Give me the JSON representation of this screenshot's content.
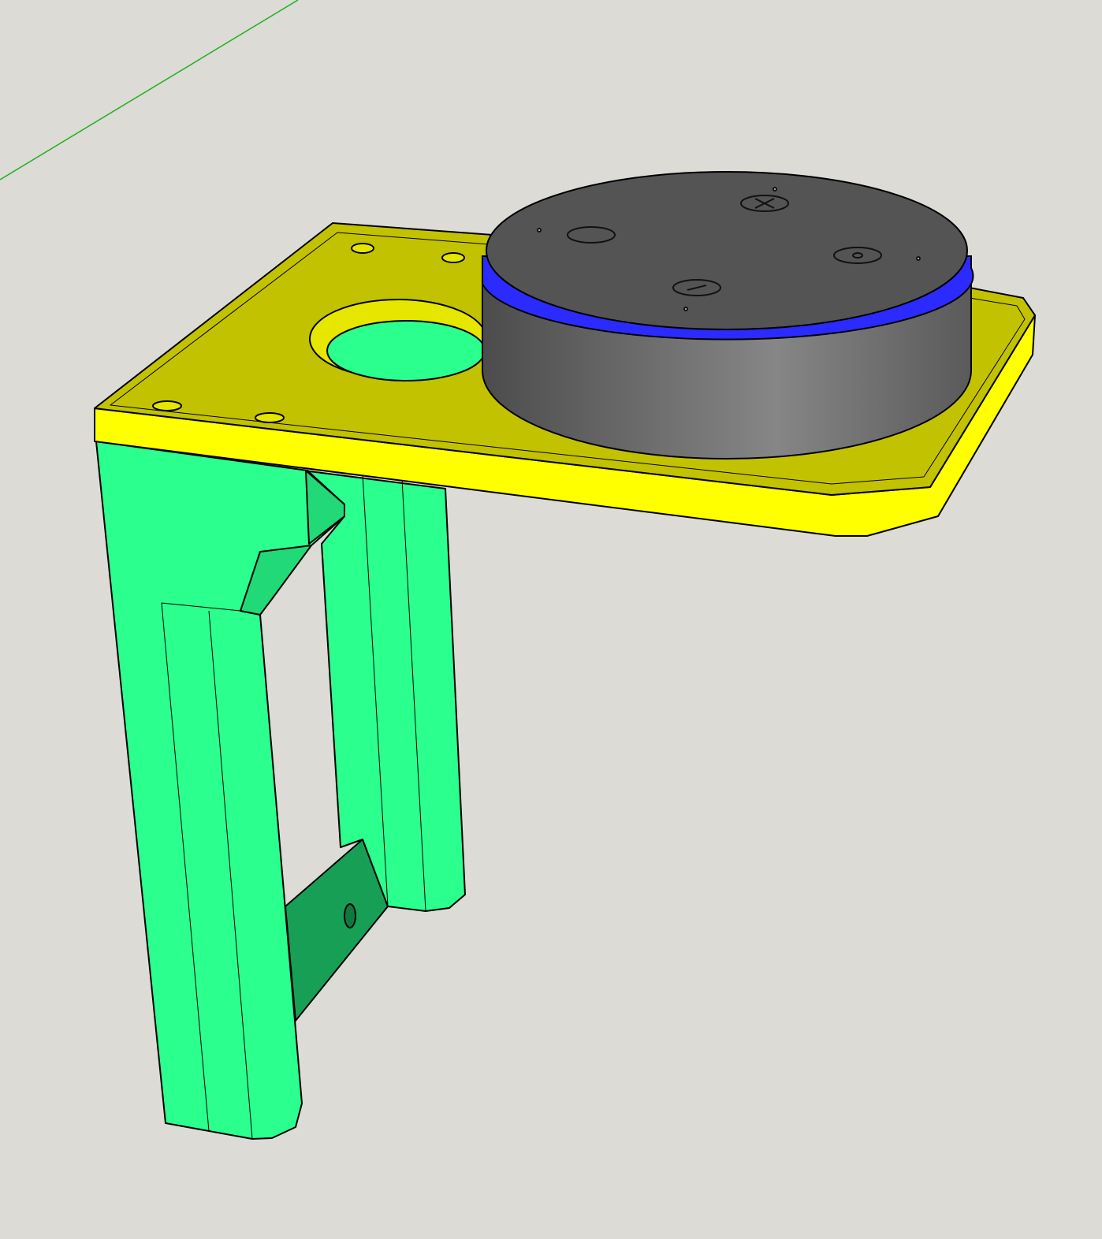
{
  "scene": {
    "background": "#dcdbd6",
    "axis_color": "#1fb01f",
    "plate": {
      "top": "#c2c200",
      "side": "#ffff00",
      "edge": "#e6e600"
    },
    "stand": {
      "light": "#2bff8e",
      "mid": "#22d977",
      "dark": "#17a055"
    },
    "puck": {
      "top": "#545454",
      "side_dark": "#4f4f4f",
      "side_light": "#8a8a8a",
      "ring": "#2b2bff"
    },
    "puck_buttons": [
      "action-icon",
      "volume-up-icon",
      "volume-down-icon",
      "mic-off-icon"
    ]
  }
}
